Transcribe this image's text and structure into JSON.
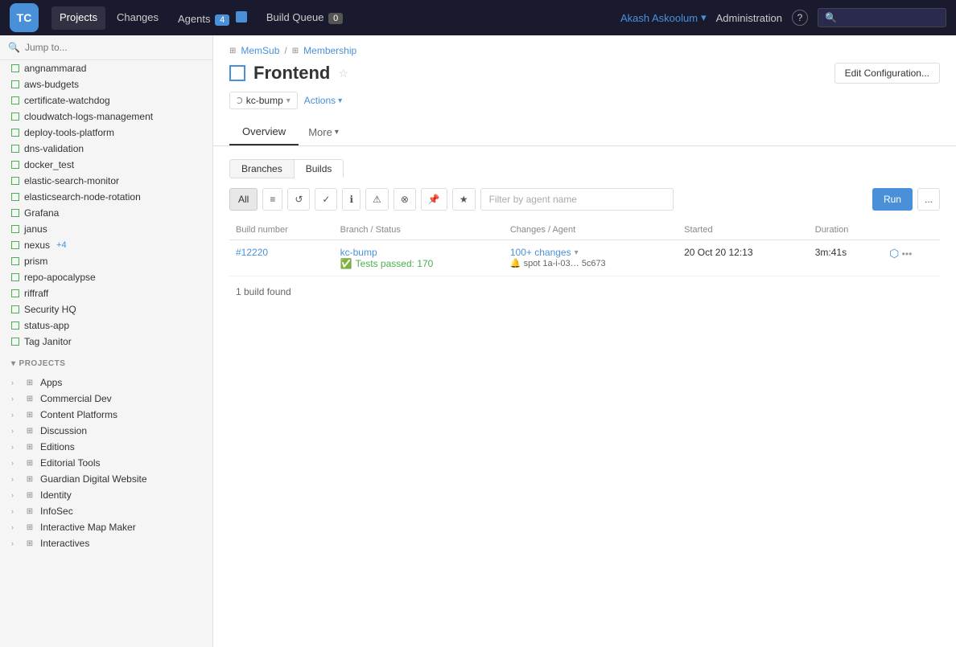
{
  "nav": {
    "logo_text": "TC",
    "links": [
      {
        "label": "Projects",
        "active": true
      },
      {
        "label": "Changes",
        "active": false
      },
      {
        "label": "Agents",
        "active": false,
        "badge": "4"
      },
      {
        "label": "Build Queue",
        "active": false,
        "badge": "0"
      }
    ],
    "user": "Akash Askoolum",
    "admin": "Administration",
    "help": "?",
    "search_placeholder": ""
  },
  "sidebar": {
    "search_placeholder": "Jump to...",
    "items": [
      {
        "label": "angnammarad",
        "icon": "green"
      },
      {
        "label": "aws-budgets",
        "icon": "green"
      },
      {
        "label": "certificate-watchdog",
        "icon": "green"
      },
      {
        "label": "cloudwatch-logs-management",
        "icon": "green"
      },
      {
        "label": "deploy-tools-platform",
        "icon": "green"
      },
      {
        "label": "dns-validation",
        "icon": "green"
      },
      {
        "label": "docker_test",
        "icon": "green"
      },
      {
        "label": "elastic-search-monitor",
        "icon": "green"
      },
      {
        "label": "elasticsearch-node-rotation",
        "icon": "green"
      },
      {
        "label": "Grafana",
        "icon": "green"
      },
      {
        "label": "janus",
        "icon": "green"
      },
      {
        "label": "nexus",
        "icon": "green",
        "badge": "+4"
      },
      {
        "label": "prism",
        "icon": "green"
      },
      {
        "label": "repo-apocalypse",
        "icon": "green"
      },
      {
        "label": "riffraff",
        "icon": "green"
      },
      {
        "label": "Security HQ",
        "icon": "green"
      },
      {
        "label": "status-app",
        "icon": "green"
      },
      {
        "label": "Tag Janitor",
        "icon": "green"
      }
    ],
    "projects_header": "PROJECTS",
    "projects": [
      {
        "label": "Apps"
      },
      {
        "label": "Commercial Dev"
      },
      {
        "label": "Content Platforms"
      },
      {
        "label": "Discussion"
      },
      {
        "label": "Editions"
      },
      {
        "label": "Editorial Tools"
      },
      {
        "label": "Guardian Digital Website"
      },
      {
        "label": "Identity"
      },
      {
        "label": "InfoSec"
      },
      {
        "label": "Interactive Map Maker"
      },
      {
        "label": "Interactives"
      }
    ]
  },
  "breadcrumb": {
    "parent1_icon": "grid",
    "parent1": "MemSub",
    "sep": "/",
    "parent2_icon": "grid",
    "parent2": "Membership"
  },
  "page": {
    "title": "Frontend",
    "star": "☆",
    "edit_config_btn": "Edit Configuration...",
    "branch_label": "kc-bump",
    "actions_label": "Actions",
    "tabs": [
      {
        "label": "Overview",
        "active": true
      },
      {
        "label": "More"
      }
    ],
    "inner_tabs": [
      {
        "label": "Branches",
        "active": false
      },
      {
        "label": "Builds",
        "active": true
      }
    ],
    "filter_buttons": [
      {
        "label": "All",
        "active": true
      },
      {
        "label": "queued",
        "icon": "≡"
      },
      {
        "label": "running",
        "icon": "↺"
      },
      {
        "label": "success",
        "icon": "✓"
      },
      {
        "label": "info",
        "icon": "ℹ"
      },
      {
        "label": "warning",
        "icon": "⚠"
      },
      {
        "label": "error",
        "icon": "⊗"
      },
      {
        "label": "pinned",
        "icon": "⊕"
      },
      {
        "label": "starred",
        "icon": "★"
      }
    ],
    "filter_placeholder": "Filter by agent name",
    "run_btn": "Run",
    "more_btn": "...",
    "table": {
      "headers": [
        "Build number",
        "Branch / Status",
        "Changes / Agent",
        "Started",
        "Duration"
      ],
      "rows": [
        {
          "build_num": "#12220",
          "branch": "kc-bump",
          "status": "Tests passed: 170",
          "changes": "100+ changes",
          "agent": "spot 1a-i-03… 5c673",
          "started": "20 Oct 20 12:13",
          "duration": "3m:41s"
        }
      ]
    },
    "builds_found": "1 build found"
  }
}
